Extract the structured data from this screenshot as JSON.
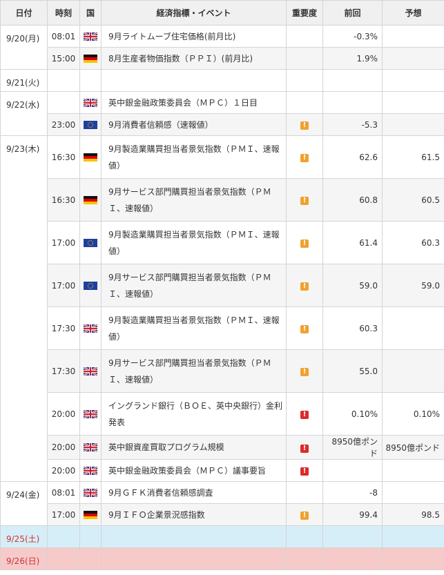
{
  "headers": [
    "日付",
    "時刻",
    "国",
    "経済指標・イベント",
    "重要度",
    "前回",
    "予想"
  ],
  "colors": {
    "orange": "#f0a22e",
    "red": "#dd2a2a",
    "saturday_bg": "#d6eef7",
    "sunday_bg": "#f7caca"
  },
  "days": [
    {
      "date": "9/20(月)",
      "rows": [
        {
          "time": "08:01",
          "country": "uk",
          "event": "9月ライトムーブ住宅価格(前月比)",
          "importance": "",
          "prev": "-0.3%",
          "forecast": ""
        },
        {
          "time": "15:00",
          "country": "de",
          "event": "8月生産者物価指数（ＰＰＩ）(前月比)",
          "importance": "",
          "prev": "1.9%",
          "forecast": ""
        }
      ]
    },
    {
      "date": "9/21(火)",
      "rows": [
        {
          "time": "",
          "country": "",
          "event": "",
          "importance": "",
          "prev": "",
          "forecast": ""
        }
      ]
    },
    {
      "date": "9/22(水)",
      "rows": [
        {
          "time": "",
          "country": "uk",
          "event": "英中銀金融政策委員会（ＭＰＣ）１日目",
          "importance": "",
          "prev": "",
          "forecast": ""
        },
        {
          "time": "23:00",
          "country": "eu",
          "event": "9月消費者信頼感（速報値）",
          "importance": "medium",
          "prev": "-5.3",
          "forecast": ""
        }
      ]
    },
    {
      "date": "9/23(木)",
      "rows": [
        {
          "time": "16:30",
          "country": "de",
          "event": "9月製造業購買担当者景気指数（ＰＭＩ、速報値）",
          "importance": "medium",
          "prev": "62.6",
          "forecast": "61.5",
          "tall": true
        },
        {
          "time": "16:30",
          "country": "de",
          "event": "9月サービス部門購買担当者景気指数（ＰＭＩ、速報値）",
          "importance": "medium",
          "prev": "60.8",
          "forecast": "60.5",
          "tall": true
        },
        {
          "time": "17:00",
          "country": "eu",
          "event": "9月製造業購買担当者景気指数（ＰＭＩ、速報値）",
          "importance": "medium",
          "prev": "61.4",
          "forecast": "60.3",
          "tall": true
        },
        {
          "time": "17:00",
          "country": "eu",
          "event": "9月サービス部門購買担当者景気指数（ＰＭＩ、速報値）",
          "importance": "medium",
          "prev": "59.0",
          "forecast": "59.0",
          "tall": true
        },
        {
          "time": "17:30",
          "country": "uk",
          "event": "9月製造業購買担当者景気指数（ＰＭＩ、速報値）",
          "importance": "medium",
          "prev": "60.3",
          "forecast": "",
          "tall": true
        },
        {
          "time": "17:30",
          "country": "uk",
          "event": "9月サービス部門購買担当者景気指数（ＰＭＩ、速報値）",
          "importance": "medium",
          "prev": "55.0",
          "forecast": "",
          "tall": true
        },
        {
          "time": "20:00",
          "country": "uk",
          "event": "イングランド銀行（ＢＯＥ、英中央銀行）金利発表",
          "importance": "high",
          "prev": "0.10%",
          "forecast": "0.10%",
          "tall": true
        },
        {
          "time": "20:00",
          "country": "uk",
          "event": "英中銀資産買取プログラム規模",
          "importance": "high",
          "prev": "8950億ポンド",
          "forecast": "8950億ポンド"
        },
        {
          "time": "20:00",
          "country": "uk",
          "event": "英中銀金融政策委員会（ＭＰＣ）議事要旨",
          "importance": "high",
          "prev": "",
          "forecast": ""
        }
      ]
    },
    {
      "date": "9/24(金)",
      "rows": [
        {
          "time": "08:01",
          "country": "uk",
          "event": "9月ＧＦＫ消費者信頼感調査",
          "importance": "",
          "prev": "-8",
          "forecast": ""
        },
        {
          "time": "17:00",
          "country": "de",
          "event": "9月ＩＦＯ企業景況感指数",
          "importance": "medium",
          "prev": "99.4",
          "forecast": "98.5"
        }
      ]
    },
    {
      "date": "9/25(土)",
      "weekend": "sat",
      "rows": [
        {
          "time": "",
          "country": "",
          "event": "",
          "importance": "",
          "prev": "",
          "forecast": ""
        }
      ]
    },
    {
      "date": "9/26(日)",
      "weekend": "sun",
      "rows": [
        {
          "time": "",
          "country": "",
          "event": "",
          "importance": "",
          "prev": "",
          "forecast": ""
        }
      ]
    }
  ]
}
